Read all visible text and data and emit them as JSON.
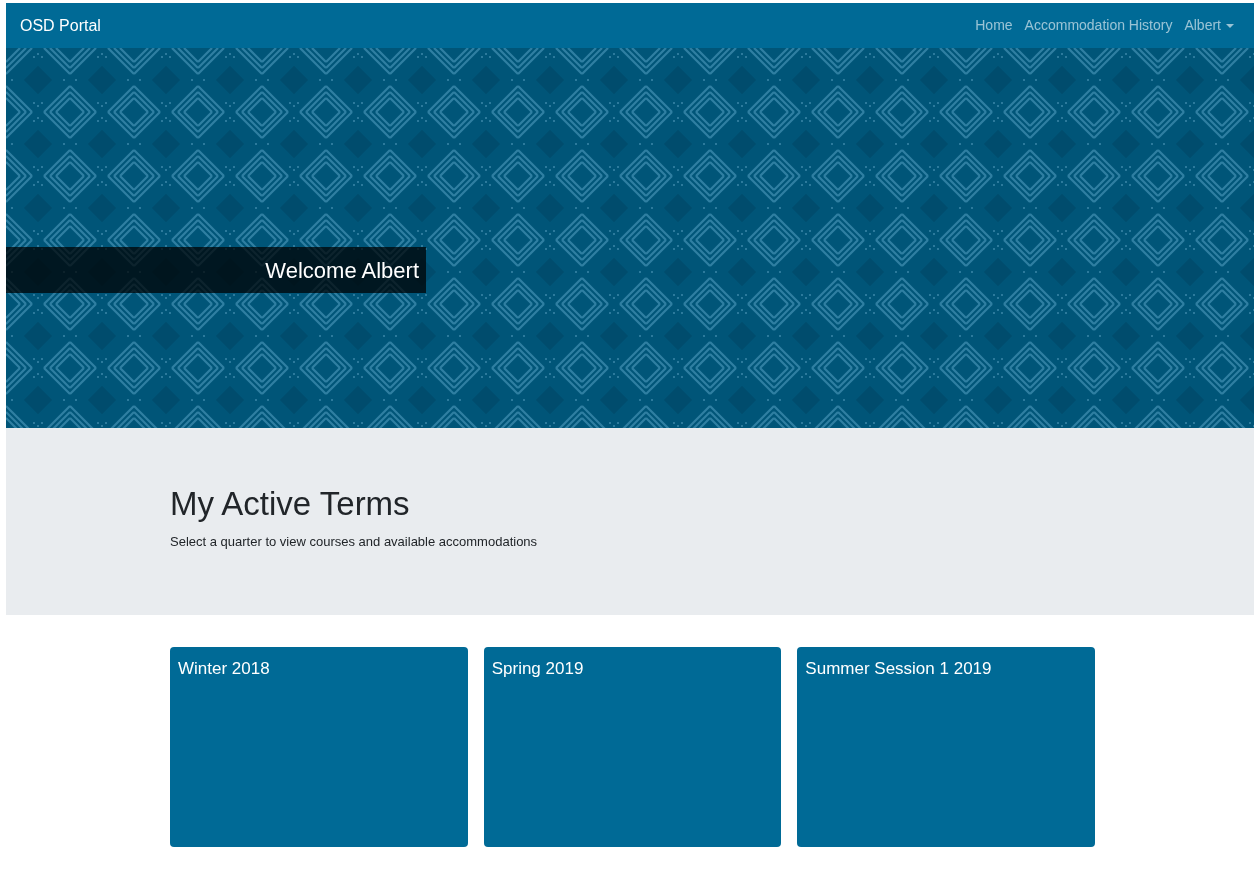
{
  "navbar": {
    "brand": "OSD Portal",
    "links": [
      {
        "label": "Home",
        "kind": "link"
      },
      {
        "label": "Accommodation History",
        "kind": "link"
      },
      {
        "label": "Albert",
        "kind": "dropdown"
      }
    ]
  },
  "hero": {
    "welcome": "Welcome Albert"
  },
  "intro": {
    "heading": "My Active Terms",
    "subtitle": "Select a quarter to view courses and available accommodations"
  },
  "terms": [
    {
      "title": "Winter 2018"
    },
    {
      "title": "Spring 2019"
    },
    {
      "title": "Summer Session 1 2019"
    }
  ]
}
